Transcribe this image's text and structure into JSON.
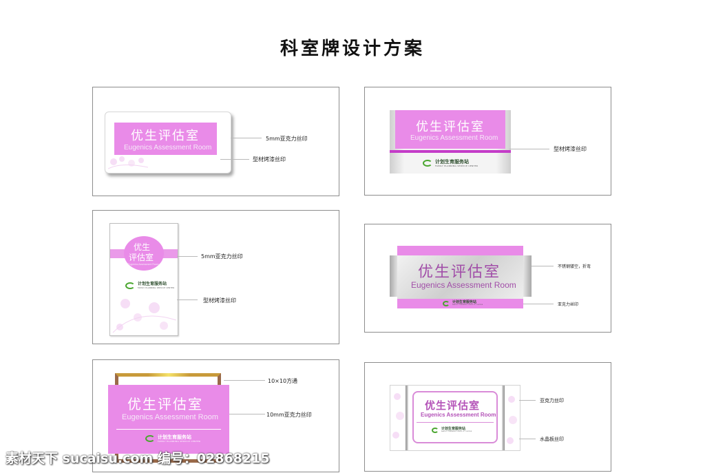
{
  "page": {
    "title": "科室牌设计方案"
  },
  "sign_text": {
    "cn": "优生评估室",
    "cn_line1": "优生",
    "cn_line2": "评估室",
    "en": "Eugenics Assessment Room",
    "en_small": "Eugenics Assessment Room"
  },
  "logo": {
    "name": "计划生育服务站",
    "sub": "FAMILY PLANNING SERVICE CENTER",
    "icon": "family-planning-logo-icon"
  },
  "panels": {
    "p1": {
      "notes": [
        "5mm亚克力丝印",
        "型材烤漆丝印"
      ]
    },
    "p2": {
      "notes": [
        "型材烤漆丝印"
      ]
    },
    "p3": {
      "notes": [
        "5mm亚克力丝印",
        "型材烤漆丝印"
      ]
    },
    "p4": {
      "notes": [
        "不锈钢镂空，折弯",
        "亚克力丝印"
      ]
    },
    "p5": {
      "notes": [
        "10×10方通",
        "10mm亚克力丝印"
      ]
    },
    "p6": {
      "notes": [
        "亚克力丝印",
        "水晶板丝印"
      ]
    }
  },
  "watermark": {
    "text": "素材天下 sucaisu.com   编号：02868215"
  },
  "colors": {
    "pink": "#e88ae6",
    "pink_light": "#f3c8f2",
    "magenta_bar": "#c43cc8",
    "frame_brown": "#9a6a4a",
    "silver": "#d9d9d9",
    "logo_green": "#4aa62f"
  }
}
